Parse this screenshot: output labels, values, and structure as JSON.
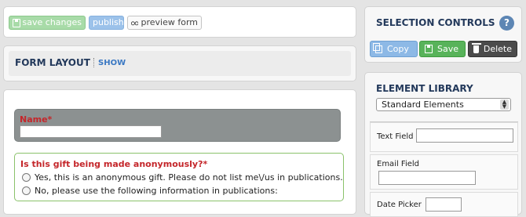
{
  "toolbar": {
    "save_changes": "save changes",
    "publish": "publish",
    "preview_form": "preview form"
  },
  "form_layout": {
    "title": "FORM LAYOUT",
    "show_link": "SHOW"
  },
  "form": {
    "name_label": "Name*",
    "name_value": "",
    "anon_question": "Is this gift being made anonymously?*",
    "options": [
      "Yes, this is an anonymous gift. Please do not list me\\/us in publications.",
      "No, please use the following information in publications:"
    ]
  },
  "selection_controls": {
    "title": "SELECTION CONTROLS",
    "help": "?",
    "copy": "Copy",
    "save": "Save",
    "delete": "Delete"
  },
  "element_library": {
    "title": "ELEMENT LIBRARY",
    "selected": "Standard Elements",
    "items": [
      "Text Field",
      "Email Field",
      "Date Picker"
    ]
  },
  "colors": {
    "heading": "#23395b",
    "required_red": "#c4262a",
    "save_green": "#58b35a",
    "copy_blue": "#8db9e6",
    "delete_dark": "#4b4b4b"
  }
}
